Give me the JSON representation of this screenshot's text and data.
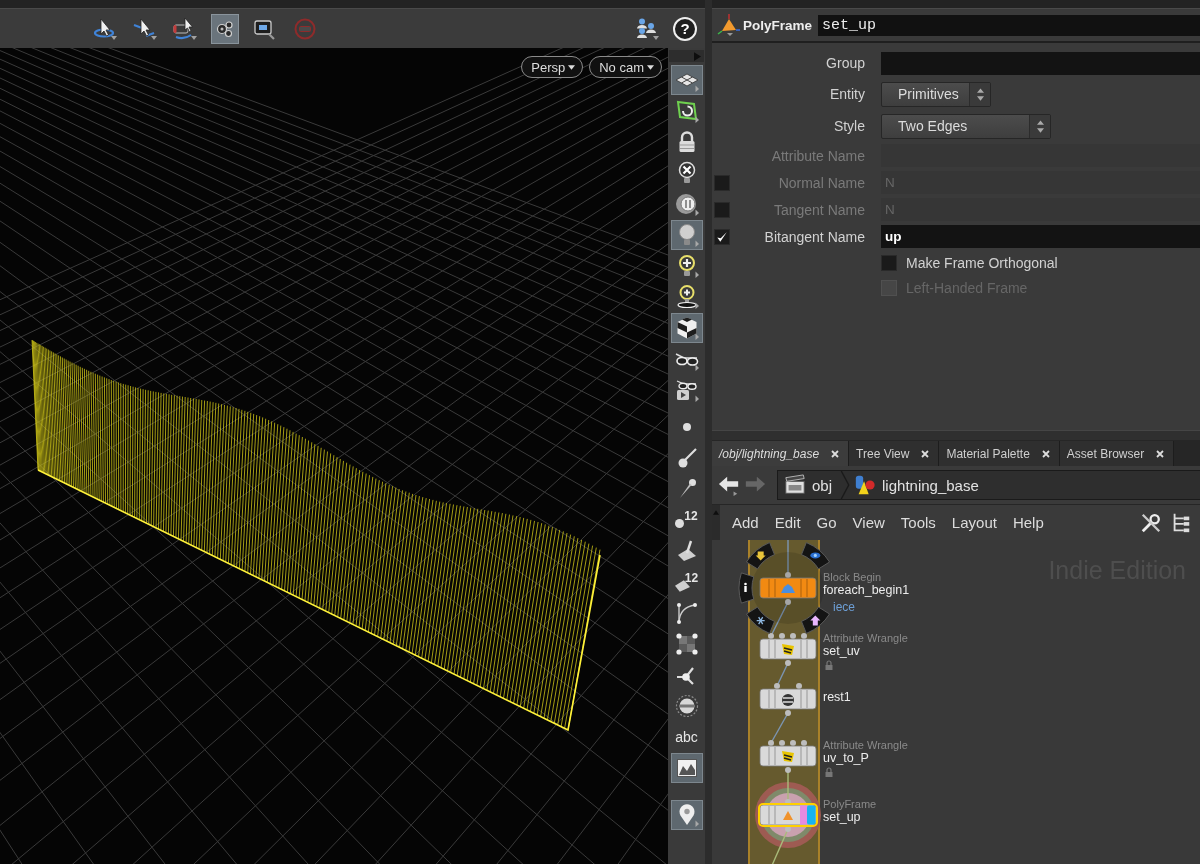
{
  "viewport": {
    "toolbar": {
      "left": [
        {
          "kind": "orbit",
          "selected": false
        },
        {
          "kind": "pan",
          "selected": false
        },
        {
          "kind": "camera",
          "selected": false
        },
        {
          "kind": "rig",
          "selected": true
        },
        {
          "kind": "frame",
          "selected": false
        },
        {
          "kind": "stop",
          "selected": false
        }
      ],
      "right": [
        {
          "kind": "users",
          "selected": false
        },
        {
          "kind": "help",
          "label": "?"
        }
      ]
    },
    "view_menus": [
      {
        "label": "Persp"
      },
      {
        "label": "No cam"
      }
    ],
    "display_toolbar": [
      {
        "kind": "plane",
        "selected": true
      },
      {
        "kind": "snap",
        "selected": false
      },
      {
        "kind": "lock",
        "selected": false
      },
      {
        "kind": "lightoff",
        "selected": false
      },
      {
        "kind": "knob",
        "selected": false
      },
      {
        "kind": "bulb",
        "selected": true
      },
      {
        "kind": "lightadd",
        "selected": false
      },
      {
        "kind": "lightstand",
        "selected": false
      },
      {
        "kind": "cube",
        "selected": true
      },
      {
        "kind": "glasses",
        "selected": false
      },
      {
        "kind": "glassesplay",
        "selected": false
      },
      {
        "kind": "dot",
        "selected": false
      },
      {
        "kind": "brush",
        "selected": false
      },
      {
        "kind": "pin",
        "selected": false
      },
      {
        "kind": "pointnum",
        "label": "12",
        "selected": false
      },
      {
        "kind": "face",
        "selected": false
      },
      {
        "kind": "primnum",
        "label": "12",
        "selected": false
      },
      {
        "kind": "curve",
        "selected": false
      },
      {
        "kind": "bbox",
        "selected": false
      },
      {
        "kind": "handle",
        "selected": false
      },
      {
        "kind": "disk",
        "selected": false
      },
      {
        "kind": "text",
        "label": "abc",
        "selected": false
      },
      {
        "kind": "image",
        "selected": true
      },
      {
        "kind": "marker",
        "selected": true
      }
    ]
  },
  "parameters": {
    "node_type": "PolyFrame",
    "node_name": "set_up",
    "items": [
      {
        "kind": "text",
        "label": "Group",
        "disabled": false
      },
      {
        "kind": "menu",
        "label": "Entity",
        "value": "Primitives",
        "disabled": false
      },
      {
        "kind": "menu",
        "label": "Style",
        "value": "Two Edges",
        "disabled": false
      },
      {
        "kind": "text",
        "label": "Attribute Name",
        "disabled": true
      },
      {
        "kind": "text",
        "label": "Normal Name",
        "value": "N",
        "disabled": true,
        "checked": false,
        "changed": false
      },
      {
        "kind": "text",
        "label": "Tangent Name",
        "value": "N",
        "disabled": true,
        "checked": false,
        "changed": false
      },
      {
        "kind": "text",
        "label": "Bitangent Name",
        "value": "up",
        "disabled": false,
        "checked": true,
        "changed": true
      },
      {
        "kind": "toggle",
        "label": "Make Frame Orthogonal",
        "checked": false,
        "disabled": false
      },
      {
        "kind": "toggle",
        "label": "Left-Handed Frame",
        "checked": false,
        "disabled": true
      }
    ]
  },
  "network": {
    "tabs": [
      {
        "label": "/obj/lightning_base",
        "selected": true
      },
      {
        "label": "Tree View",
        "selected": false
      },
      {
        "label": "Material Palette",
        "selected": false
      },
      {
        "label": "Asset Browser",
        "selected": false
      }
    ],
    "navigation": {
      "back": {
        "disabled": false
      },
      "forward": {
        "disabled": true
      }
    },
    "path": [
      {
        "kind": "obj",
        "label": "obj"
      },
      {
        "kind": "geo",
        "label": "lightning_base"
      }
    ],
    "menu": [
      "Add",
      "Edit",
      "Go",
      "View",
      "Tools",
      "Layout",
      "Help"
    ],
    "edition": "Indie Edition",
    "nodes": [
      {
        "kind": "block",
        "type": "Block Begin",
        "name": "foreach_begin1",
        "note": "iece",
        "color": "#f28a12",
        "selected": false,
        "display": false,
        "menu_open": true
      },
      {
        "kind": "wrangle",
        "type": "Attribute Wrangle",
        "name": "set_uv",
        "color": "#d9d9d9",
        "selected": false,
        "display": false,
        "menu_open": false
      },
      {
        "kind": "rest",
        "name": "rest1",
        "color": "#d9d9d9",
        "selected": false,
        "display": false,
        "menu_open": false
      },
      {
        "kind": "wrangle",
        "type": "Attribute Wrangle",
        "name": "uv_to_P",
        "color": "#d9d9d9",
        "selected": false,
        "display": false,
        "menu_open": false
      },
      {
        "kind": "polyframe",
        "type": "PolyFrame",
        "name": "set_up",
        "color": "#d9d9d9",
        "selected": true,
        "display": true,
        "menu_open": false
      }
    ]
  }
}
